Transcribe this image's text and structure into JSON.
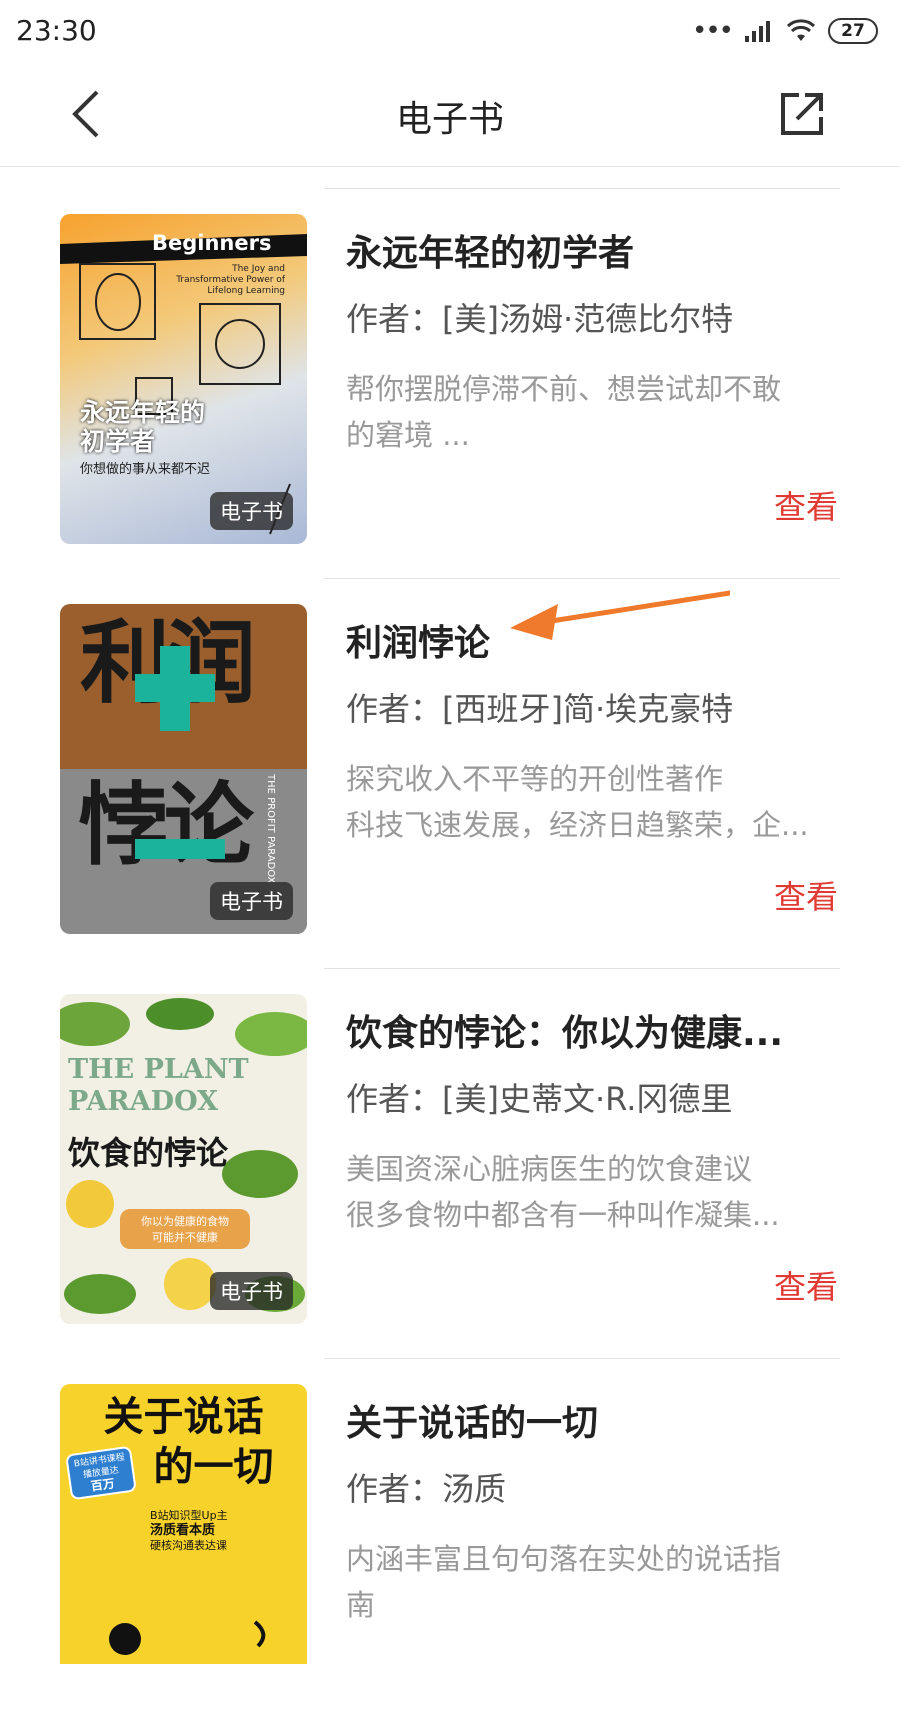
{
  "status_bar": {
    "time": "23:30",
    "battery": "27"
  },
  "header": {
    "title": "电子书"
  },
  "badge_label": "电子书",
  "colors": {
    "accent": "#e03a32",
    "annotation_arrow": "#f07a2c"
  },
  "books": [
    {
      "title": "永远年轻的初学者",
      "author": "作者：[美]汤姆·范德比尔特",
      "desc": [
        "帮你摆脱停滞不前、想尝试却不敢",
        "的窘境 ..."
      ],
      "view_label": "查看",
      "cover": {
        "title_en": "Beginners",
        "subtitle_en": [
          "The Joy and",
          "Transformative Power of",
          "Lifelong Learning"
        ],
        "title_cn": [
          "永远年轻的",
          "初学者"
        ],
        "tagline_cn": "你想做的事从来都不迟"
      }
    },
    {
      "title": "利润悖论",
      "author": "作者：[西班牙]简·埃克豪特",
      "desc": [
        "探究收入不平等的开创性著作",
        "科技飞速发展，经济日趋繁荣，企..."
      ],
      "view_label": "查看",
      "cover": {
        "title_top": "利润",
        "title_bottom": "悖论",
        "side_text": "THE PROFIT PARADOX"
      }
    },
    {
      "title": "饮食的悖论：你以为健康...",
      "author": "作者：[美]史蒂文·R.冈德里",
      "desc": [
        "美国资深心脏病医生的饮食建议",
        "很多食物中都含有一种叫作凝集..."
      ],
      "view_label": "查看",
      "cover": {
        "title_en": [
          "THE PLANT",
          "PARADOX"
        ],
        "title_cn": "饮食的悖论",
        "tagline_cn": [
          "你以为健康的食物",
          "可能并不健康"
        ]
      }
    },
    {
      "title": "关于说话的一切",
      "author": "作者：汤质",
      "desc": [
        "内涵丰富且句句落在实处的说话指",
        "南"
      ],
      "cover": {
        "title_cn": [
          "关于说话",
          "的一切"
        ],
        "stamp": [
          "B站讲书课程",
          "播放量达",
          "百万"
        ],
        "tagline_cn": [
          "B站知识型Up主",
          "汤质看本质",
          "硬核沟通表达课"
        ]
      }
    }
  ]
}
